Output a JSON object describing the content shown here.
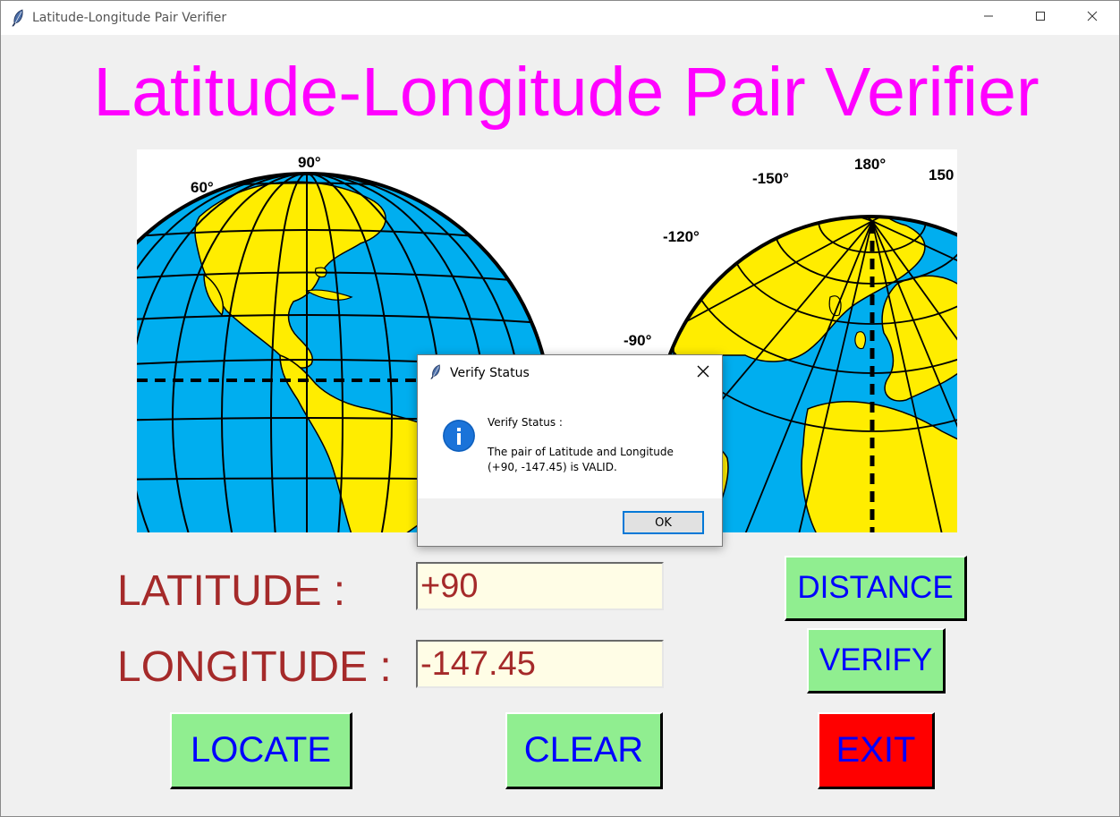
{
  "window": {
    "title": "Latitude-Longitude Pair Verifier",
    "icon": "feather-icon",
    "controls": [
      "minimize-icon",
      "maximize-icon",
      "close-icon"
    ]
  },
  "heading": "Latitude-Longitude Pair Verifier",
  "map": {
    "labels_west": [
      "60°",
      "90°"
    ],
    "labels_east": [
      "-150°",
      "180°",
      "150",
      "-120°",
      "-90°"
    ]
  },
  "form": {
    "latitude_label": "LATITUDE :",
    "latitude_value": "+90",
    "longitude_label": "LONGITUDE :",
    "longitude_value": "-147.45"
  },
  "buttons": {
    "distance": "DISTANCE",
    "verify": "VERIFY",
    "locate": "LOCATE",
    "clear": "CLEAR",
    "exit": "EXIT"
  },
  "dialog": {
    "title": "Verify Status",
    "icon": "info-icon",
    "heading": "Verify Status :",
    "line1": "The pair of Latitude and Longitude",
    "line2": "(+90, -147.45) is VALID.",
    "ok_label": "OK"
  },
  "colors": {
    "heading": "#ff00ff",
    "label": "#a52a2a",
    "button_bg": "#90ee90",
    "button_text": "#0000ff",
    "exit_bg": "#ff0000",
    "entry_bg": "#fffde6",
    "ocean": "#00aeef",
    "land": "#ffed00"
  }
}
